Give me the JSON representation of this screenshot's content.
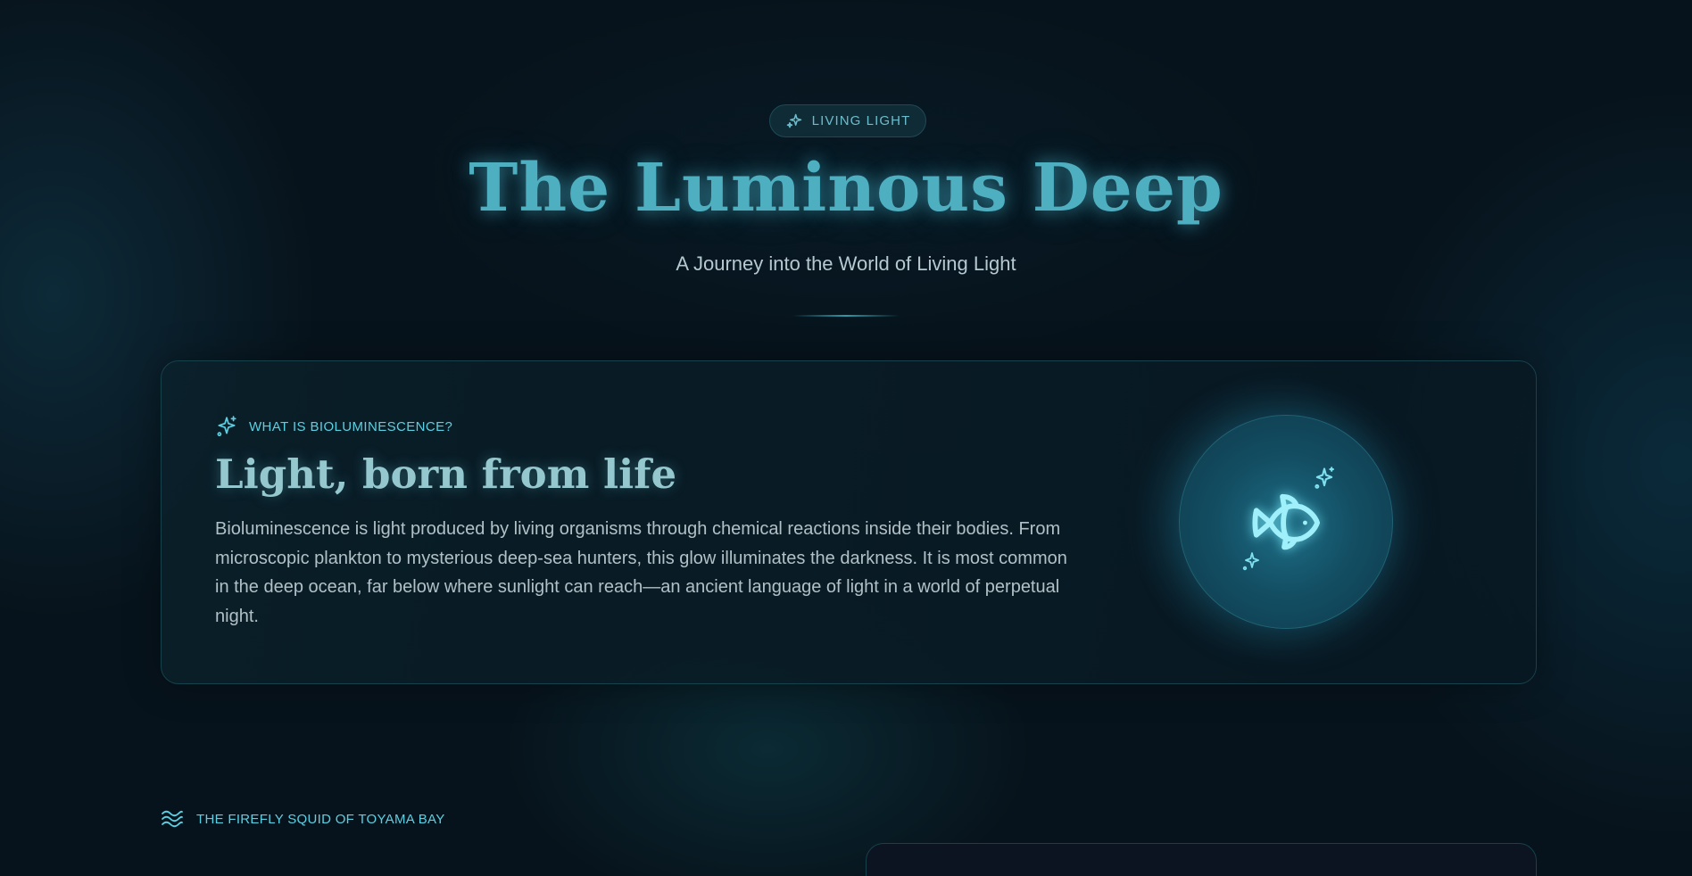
{
  "hero": {
    "badge_label": "LIVING LIGHT",
    "badge_icon": "sparkles-icon",
    "title": "The Luminous Deep",
    "subtitle": "A Journey into the World of Living Light"
  },
  "intro_card": {
    "eyebrow_icon": "sparkles-icon",
    "eyebrow": "WHAT IS BIOLUMINESCENCE?",
    "title": "Light, born from life",
    "body": "Bioluminescence is light produced by living organisms through chemical reactions inside their bodies. From microscopic plankton to mysterious deep-sea hunters, this glow illuminates the darkness. It is most common in the deep ocean, far below where sunlight can reach—an ancient language of light in a world of perpetual night.",
    "orb_icon": "fish-icon"
  },
  "section2": {
    "eyebrow_icon": "waves-icon",
    "eyebrow": "THE FIREFLY SQUID OF TOYAMA BAY"
  },
  "colors": {
    "background": "#07131c",
    "accent": "#5cd0e2",
    "title": "#4eafc1",
    "card_border": "#17414b"
  }
}
